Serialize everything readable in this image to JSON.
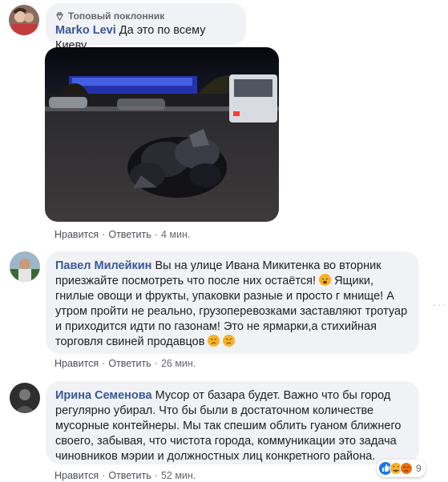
{
  "comments": [
    {
      "badge": "Топовый поклонник",
      "author": "Marko Levi",
      "text": "Да это по всему Киеву",
      "like": "Нравится",
      "reply": "Ответить",
      "time": "4 мин."
    },
    {
      "author": "Павел Милейкин",
      "text_a": "Вы на улице Ивана Микитенка во вторник приезжайте посмотреть что после них остаётся!",
      "text_b": "Ящики, гнилые овощи и фрукты, упаковки разные и просто г мнище! А утром пройти не реально, грузоперевозками заставляют тротуар и приходится идти по газонам! Это не ярмарки,а стихийная торговля свиней продавцов",
      "like": "Нравится",
      "reply": "Ответить",
      "time": "26 мин."
    },
    {
      "author": "Ирина Семенова",
      "text": "Мусор от базара будет. Важно что бы город регулярно убирал. Что бы были в достаточном количестве мусорные контейнеры. Мы так спешим облить гуаном ближнего своего, забывая, что чистота города, коммуникации это задача чиновников мэрии и должностных лиц конкретного района.",
      "reaction_count": "9",
      "like": "Нравится",
      "reply": "Ответить",
      "time": "52 мин."
    }
  ],
  "colors": {
    "name": "#385898",
    "bubble": "#f0f2f5",
    "meta": "#65676b"
  },
  "icons": [
    "top-fan-badge-icon",
    "more-options-icon",
    "like-reaction-icon",
    "haha-reaction-icon",
    "angry-reaction-icon"
  ]
}
